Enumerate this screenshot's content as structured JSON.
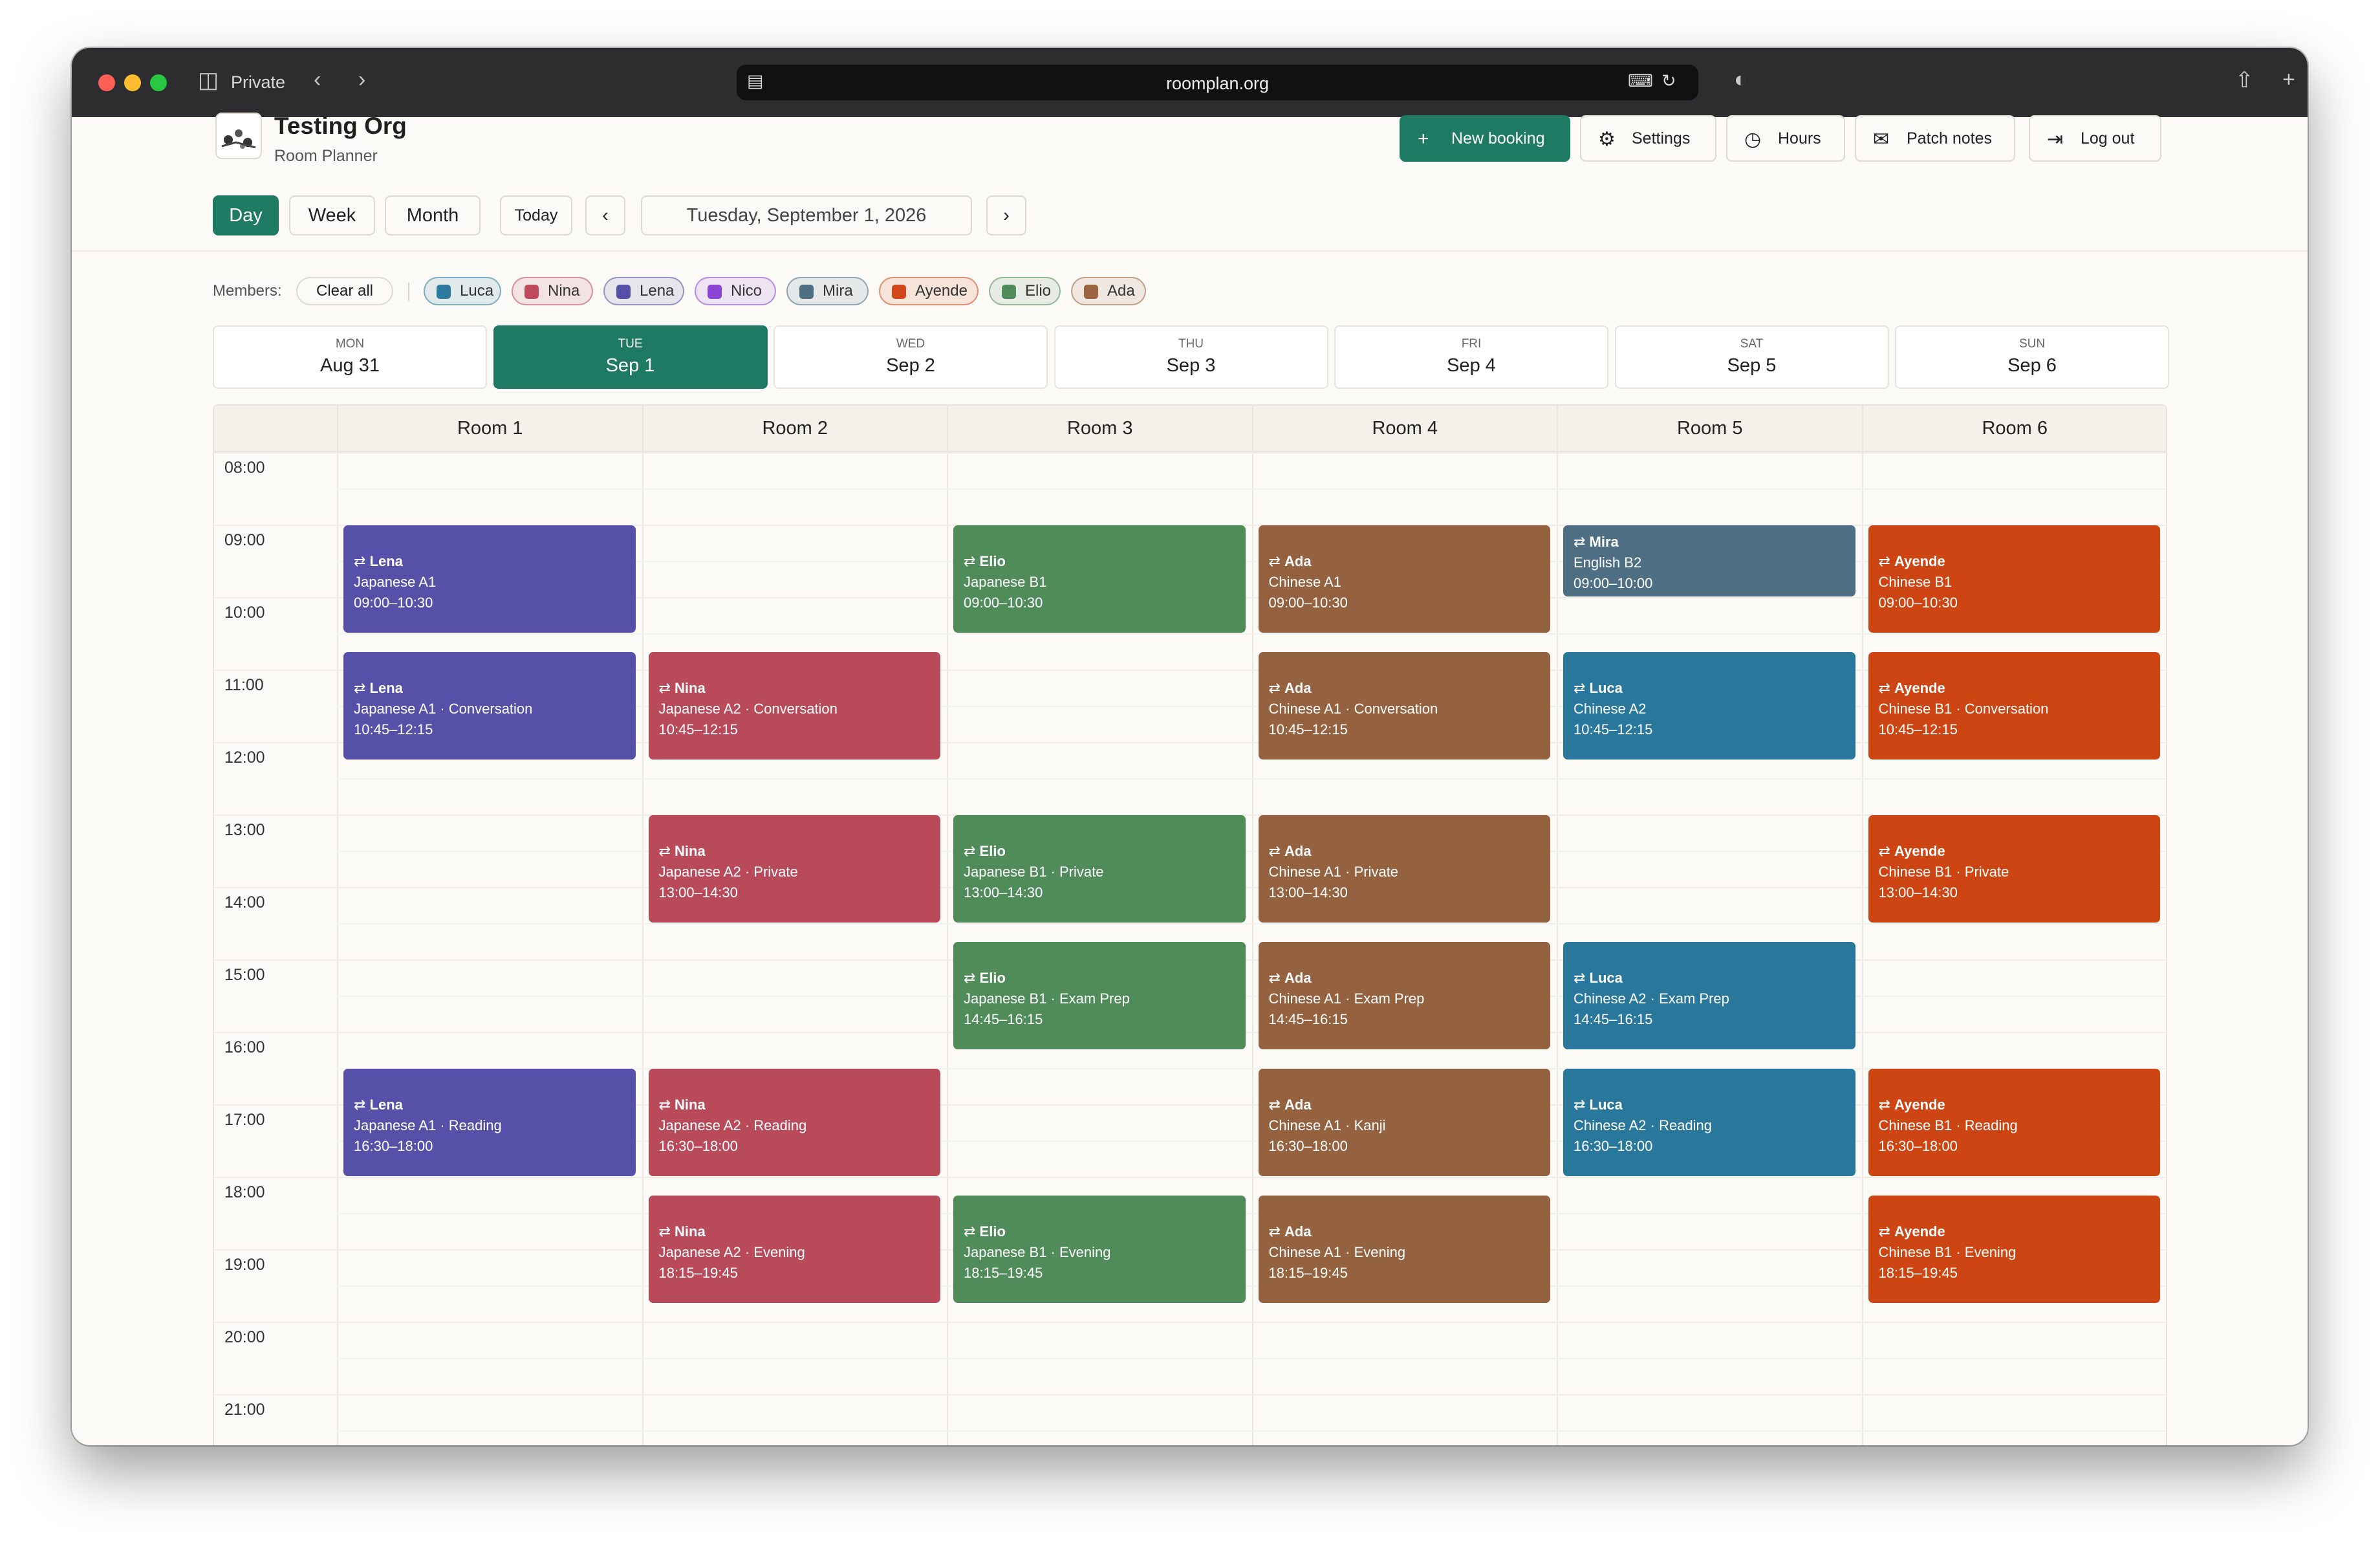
{
  "browser": {
    "mode_label": "Private",
    "url": "roomplan.org"
  },
  "header": {
    "org_name": "Testing Org",
    "subtitle": "Room Planner"
  },
  "actions": {
    "new_booking": "New booking",
    "settings": "Settings",
    "hours": "Hours",
    "patch_notes": "Patch notes",
    "log_out": "Log out"
  },
  "view": {
    "day": "Day",
    "week": "Week",
    "month": "Month",
    "today": "Today",
    "current_date": "Tuesday, September 1, 2026",
    "active_view": "Day"
  },
  "members": {
    "label": "Members:",
    "clear_all": "Clear all",
    "items": [
      {
        "name": "Luca",
        "color": "#2d7aa0"
      },
      {
        "name": "Nina",
        "color": "#c04a5c"
      },
      {
        "name": "Lena",
        "color": "#5750a8"
      },
      {
        "name": "Nico",
        "color": "#8a45d6"
      },
      {
        "name": "Mira",
        "color": "#4e6e84"
      },
      {
        "name": "Ayende",
        "color": "#d2481a"
      },
      {
        "name": "Elio",
        "color": "#4f8c5a"
      },
      {
        "name": "Ada",
        "color": "#9a6440"
      }
    ]
  },
  "days": [
    {
      "dow": "MON",
      "date": "Aug 31"
    },
    {
      "dow": "TUE",
      "date": "Sep 1",
      "active": true
    },
    {
      "dow": "WED",
      "date": "Sep 2"
    },
    {
      "dow": "THU",
      "date": "Sep 3"
    },
    {
      "dow": "FRI",
      "date": "Sep 4"
    },
    {
      "dow": "SAT",
      "date": "Sep 5"
    },
    {
      "dow": "SUN",
      "date": "Sep 6"
    }
  ],
  "rooms": [
    "Room 1",
    "Room 2",
    "Room 3",
    "Room 4",
    "Room 5",
    "Room 6"
  ],
  "times": [
    "08:00",
    "09:00",
    "10:00",
    "11:00",
    "12:00",
    "13:00",
    "14:00",
    "15:00",
    "16:00",
    "17:00",
    "18:00",
    "19:00",
    "20:00",
    "21:00"
  ],
  "bookings": [
    {
      "room": 0,
      "start": "09:00",
      "end": "10:30",
      "member": "Lena",
      "course": "Japanese A1",
      "time": "09:00–10:30",
      "color": "#5750a8"
    },
    {
      "room": 0,
      "start": "10:45",
      "end": "12:15",
      "member": "Lena",
      "course": "Japanese A1 · Conversation",
      "time": "10:45–12:15",
      "color": "#5750a8"
    },
    {
      "room": 0,
      "start": "16:30",
      "end": "18:00",
      "member": "Lena",
      "course": "Japanese A1 · Reading",
      "time": "16:30–18:00",
      "color": "#5750a8"
    },
    {
      "room": 1,
      "start": "10:45",
      "end": "12:15",
      "member": "Nina",
      "course": "Japanese A2 · Conversation",
      "time": "10:45–12:15",
      "color": "#b94a5a"
    },
    {
      "room": 1,
      "start": "13:00",
      "end": "14:30",
      "member": "Nina",
      "course": "Japanese A2 · Private",
      "time": "13:00–14:30",
      "color": "#b94a5a"
    },
    {
      "room": 1,
      "start": "16:30",
      "end": "18:00",
      "member": "Nina",
      "course": "Japanese A2 · Reading",
      "time": "16:30–18:00",
      "color": "#b94a5a"
    },
    {
      "room": 1,
      "start": "18:15",
      "end": "19:45",
      "member": "Nina",
      "course": "Japanese A2 · Evening",
      "time": "18:15–19:45",
      "color": "#b94a5a"
    },
    {
      "room": 2,
      "start": "09:00",
      "end": "10:30",
      "member": "Elio",
      "course": "Japanese B1",
      "time": "09:00–10:30",
      "color": "#4f8c5a"
    },
    {
      "room": 2,
      "start": "13:00",
      "end": "14:30",
      "member": "Elio",
      "course": "Japanese B1 · Private",
      "time": "13:00–14:30",
      "color": "#4f8c5a"
    },
    {
      "room": 2,
      "start": "14:45",
      "end": "16:15",
      "member": "Elio",
      "course": "Japanese B1 · Exam Prep",
      "time": "14:45–16:15",
      "color": "#4f8c5a"
    },
    {
      "room": 2,
      "start": "18:15",
      "end": "19:45",
      "member": "Elio",
      "course": "Japanese B1 · Evening",
      "time": "18:15–19:45",
      "color": "#4f8c5a"
    },
    {
      "room": 3,
      "start": "09:00",
      "end": "10:30",
      "member": "Ada",
      "course": "Chinese A1",
      "time": "09:00–10:30",
      "color": "#956240"
    },
    {
      "room": 3,
      "start": "10:45",
      "end": "12:15",
      "member": "Ada",
      "course": "Chinese A1 · Conversation",
      "time": "10:45–12:15",
      "color": "#956240"
    },
    {
      "room": 3,
      "start": "13:00",
      "end": "14:30",
      "member": "Ada",
      "course": "Chinese A1 · Private",
      "time": "13:00–14:30",
      "color": "#956240"
    },
    {
      "room": 3,
      "start": "14:45",
      "end": "16:15",
      "member": "Ada",
      "course": "Chinese A1 · Exam Prep",
      "time": "14:45–16:15",
      "color": "#956240"
    },
    {
      "room": 3,
      "start": "16:30",
      "end": "18:00",
      "member": "Ada",
      "course": "Chinese A1 · Kanji",
      "time": "16:30–18:00",
      "color": "#956240"
    },
    {
      "room": 3,
      "start": "18:15",
      "end": "19:45",
      "member": "Ada",
      "course": "Chinese A1 · Evening",
      "time": "18:15–19:45",
      "color": "#956240"
    },
    {
      "room": 4,
      "start": "09:00",
      "end": "10:00",
      "member": "Mira",
      "course": "English B2",
      "time": "09:00–10:00",
      "color": "#4e6e84"
    },
    {
      "room": 4,
      "start": "10:45",
      "end": "12:15",
      "member": "Luca",
      "course": "Chinese A2",
      "time": "10:45–12:15",
      "color": "#2a779c"
    },
    {
      "room": 4,
      "start": "14:45",
      "end": "16:15",
      "member": "Luca",
      "course": "Chinese A2 · Exam Prep",
      "time": "14:45–16:15",
      "color": "#2a779c"
    },
    {
      "room": 4,
      "start": "16:30",
      "end": "18:00",
      "member": "Luca",
      "course": "Chinese A2 · Reading",
      "time": "16:30–18:00",
      "color": "#2a779c"
    },
    {
      "room": 5,
      "start": "09:00",
      "end": "10:30",
      "member": "Ayende",
      "course": "Chinese B1",
      "time": "09:00–10:30",
      "color": "#cc4512"
    },
    {
      "room": 5,
      "start": "10:45",
      "end": "12:15",
      "member": "Ayende",
      "course": "Chinese B1 · Conversation",
      "time": "10:45–12:15",
      "color": "#cc4512"
    },
    {
      "room": 5,
      "start": "13:00",
      "end": "14:30",
      "member": "Ayende",
      "course": "Chinese B1 · Private",
      "time": "13:00–14:30",
      "color": "#cc4512"
    },
    {
      "room": 5,
      "start": "16:30",
      "end": "18:00",
      "member": "Ayende",
      "course": "Chinese B1 · Reading",
      "time": "16:30–18:00",
      "color": "#cc4512"
    },
    {
      "room": 5,
      "start": "18:15",
      "end": "19:45",
      "member": "Ayende",
      "course": "Chinese B1 · Evening",
      "time": "18:15–19:45",
      "color": "#cc4512"
    }
  ],
  "icons": {
    "add": "plus-icon",
    "settings": "gear-icon",
    "hours": "clock-icon",
    "patch_notes": "megaphone-icon",
    "log_out": "logout-icon",
    "recurring": "repeat-icon"
  }
}
